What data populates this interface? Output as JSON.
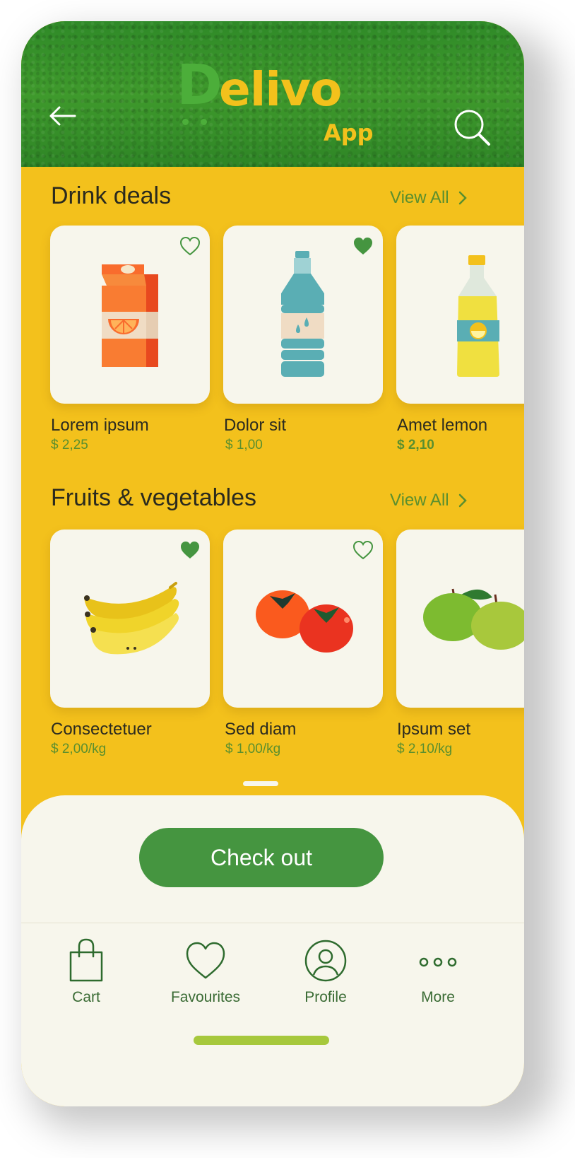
{
  "app": {
    "logo_text": "Delivo",
    "logo_sub": "App",
    "colors": {
      "header_green": "#3a922a",
      "background_yellow": "#f3c11c",
      "accent_green": "#459540",
      "card_bg": "#f7f6ec",
      "price_green": "#5a8f2e"
    }
  },
  "header": {
    "back_icon": "arrow-left-icon",
    "search_icon": "search-icon"
  },
  "sections": [
    {
      "title": "Drink deals",
      "view_all": "View All",
      "products": [
        {
          "name": "Lorem ipsum",
          "price": "$ 2,25",
          "favourite": false,
          "image": "orange-juice-carton"
        },
        {
          "name": "Dolor sit",
          "price": "$ 1,00",
          "favourite": true,
          "image": "water-bottle"
        },
        {
          "name": "Amet lemon",
          "price": "$ 2,10",
          "favourite": false,
          "image": "lemon-drink-bottle"
        }
      ]
    },
    {
      "title": "Fruits & vegetables",
      "view_all": "View All",
      "products": [
        {
          "name": "Consectetuer",
          "price": "$ 2,00/kg",
          "favourite": true,
          "image": "bananas"
        },
        {
          "name": "Sed diam",
          "price": "$ 1,00/kg",
          "favourite": false,
          "image": "tomatoes"
        },
        {
          "name": "Ipsum set",
          "price": "$ 2,10/kg",
          "favourite": false,
          "image": "green-apples"
        }
      ]
    }
  ],
  "checkout": {
    "label": "Check out"
  },
  "nav": [
    {
      "label": "Cart",
      "icon": "shopping-bag-icon"
    },
    {
      "label": "Favourites",
      "icon": "heart-icon"
    },
    {
      "label": "Profile",
      "icon": "user-icon"
    },
    {
      "label": "More",
      "icon": "more-icon"
    }
  ]
}
